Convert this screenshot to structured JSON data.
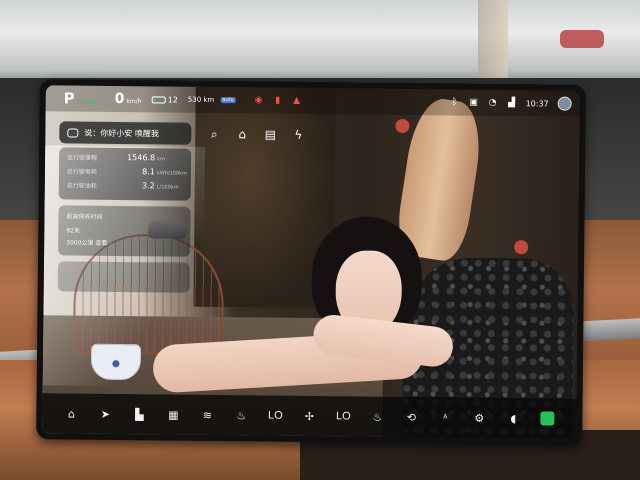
{
  "status_bar": {
    "gear": "P",
    "ready": "READY",
    "speed": "0",
    "speed_unit": "km/h",
    "battery_percent": "12",
    "battery_level": 0.13,
    "range": "530 km",
    "auto_badge": "auto",
    "time": "10:37"
  },
  "voice": {
    "prompt": "说：你好小安 唤醒我"
  },
  "trip_stats": {
    "rows": [
      {
        "label": "总行驶里程",
        "value": "1546.8",
        "unit": "km"
      },
      {
        "label": "总行驶电耗",
        "value": "8.1",
        "unit": "kWh/100km"
      },
      {
        "label": "总行驶油耗",
        "value": "3.2",
        "unit": "L/100km"
      }
    ]
  },
  "charge_card": {
    "title": "距离保养时间",
    "value": "92天",
    "sub": "3000公里 查看"
  },
  "dock": {
    "lo_left": "LO",
    "lo_right": "LO",
    "ai_label": "A"
  },
  "icons": {
    "home": "home-icon",
    "navigate": "navigation-icon",
    "car": "car-icon",
    "apps": "apps-grid-icon",
    "defrost": "defrost-icon",
    "seat": "seat-heat-icon",
    "fan": "fan-icon"
  },
  "colors": {
    "ready_green": "#34c759",
    "alert_red": "#ff4b4b",
    "app_green": "#2bbf5c"
  }
}
